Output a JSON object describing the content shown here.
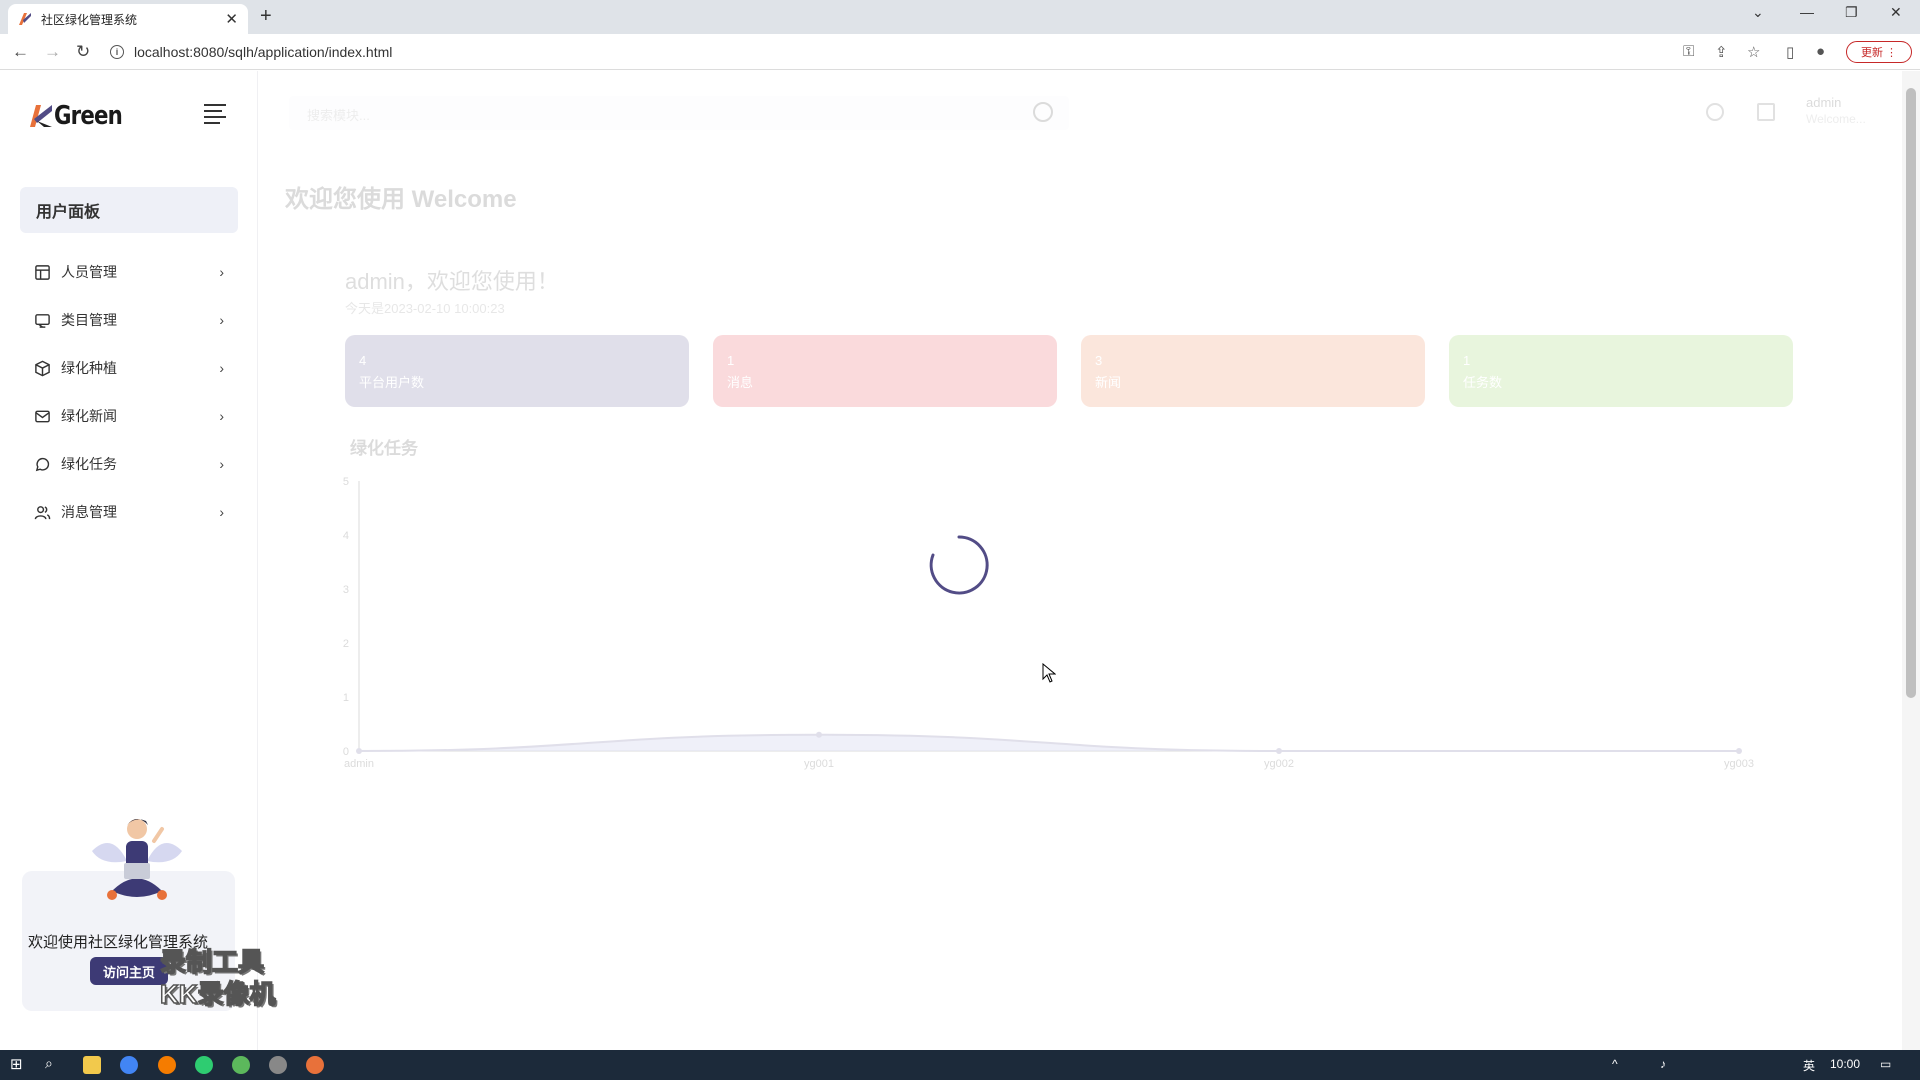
{
  "browser": {
    "tab_title": "社区绿化管理系统",
    "url": "localhost:8080/sqlh/application/index.html",
    "update_label": "更新"
  },
  "sidebar": {
    "logo_text": "Green",
    "panel_label": "用户面板",
    "items": [
      {
        "label": "人员管理",
        "icon": "table-icon"
      },
      {
        "label": "类目管理",
        "icon": "monitor-icon"
      },
      {
        "label": "绿化种植",
        "icon": "box-icon"
      },
      {
        "label": "绿化新闻",
        "icon": "mail-icon"
      },
      {
        "label": "绿化任务",
        "icon": "chat-icon"
      },
      {
        "label": "消息管理",
        "icon": "users-icon"
      }
    ],
    "promo_text": "欢迎使用社区绿化管理系统",
    "promo_button": "访问主页"
  },
  "watermark": {
    "line1": "录制工具",
    "line2": "KK录像机"
  },
  "header": {
    "search_placeholder": "搜索模块...",
    "user_name": "admin",
    "user_welcome": "Welcome..."
  },
  "main": {
    "welcome_title": "欢迎您使用 Welcome",
    "greeting": "admin，欢迎您使用！",
    "today": "今天是2023-02-10 10:00:23",
    "stats": [
      {
        "value": "4",
        "label": "平台用户数",
        "color": "#524c86"
      },
      {
        "value": "1",
        "label": "消息",
        "color": "#e0303d"
      },
      {
        "value": "3",
        "label": "新闻",
        "color": "#e8713a"
      },
      {
        "value": "1",
        "label": "任务数",
        "color": "#7cc43e"
      }
    ],
    "chart_title": "绿化任务"
  },
  "chart_data": {
    "type": "area",
    "title": "绿化任务",
    "categories": [
      "admin",
      "yg001",
      "yg002",
      "yg003"
    ],
    "values": [
      0,
      0.3,
      0,
      0
    ],
    "ylim": [
      0,
      5
    ],
    "yticks": [
      0,
      1,
      2,
      3,
      4,
      5
    ]
  },
  "taskbar": {
    "time": "10:00",
    "lang": "英"
  },
  "colors": {
    "accent": "#3d3a75",
    "panel_bg": "#eef0f7"
  }
}
